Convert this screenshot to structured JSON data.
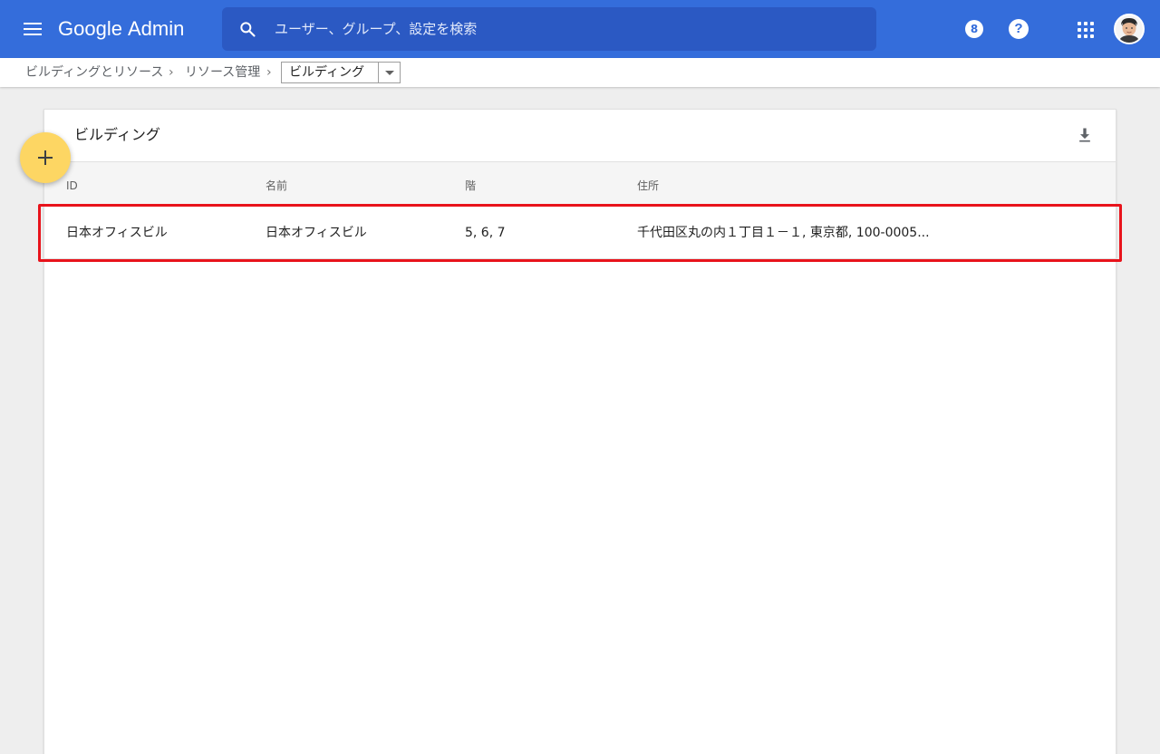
{
  "appbar": {
    "brand_google": "Google",
    "brand_admin": "Admin",
    "search_placeholder": "ユーザー、グループ、設定を検索",
    "badge_value": "8",
    "help_glyph": "?",
    "colors": {
      "appbar_bg": "#346ddb",
      "search_bg": "#2b59c3",
      "fab": "#fdd663",
      "highlight": "#e8131b"
    }
  },
  "breadcrumb": {
    "items": [
      "ビルディングとリソース",
      "リソース管理"
    ],
    "current": "ビルディング"
  },
  "card": {
    "title": "ビルディング",
    "columns": [
      "ID",
      "名前",
      "階",
      "住所"
    ],
    "rows": [
      {
        "id": "日本オフィスビル",
        "name": "日本オフィスビル",
        "floors": "5, 6, 7",
        "address": "千代田区丸の内１丁目１－１, 東京都, 100-0005..."
      }
    ]
  },
  "icons": {
    "menu": "menu-icon",
    "search": "search-icon",
    "help": "help-icon",
    "apps": "apps-grid-icon",
    "download": "download-icon",
    "add": "add-icon"
  }
}
